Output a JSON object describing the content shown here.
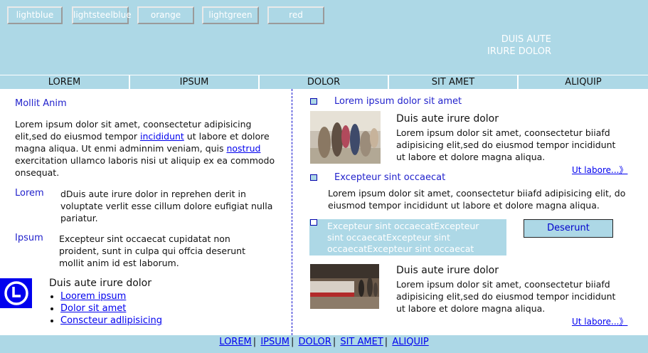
{
  "header": {
    "color_buttons": [
      "lightblue",
      "lightsteelblue",
      "orange",
      "lightgreen",
      "red"
    ],
    "title_line1": "DUIS AUTE",
    "title_line2": "IRURE DOLOR"
  },
  "nav": [
    "LOREM",
    "IPSUM",
    "DOLOR",
    "SIT AMET",
    "ALIQUIP"
  ],
  "left": {
    "title": "Mollit Anim",
    "intro": {
      "t1": "Lorem ipsum dolor sit amet, coonsectetur adipisicing elit,sed do eiusmod tempor ",
      "link1": "incididunt",
      "t2": " ut labore et dolore magna aliqua. Ut enmi adminnim veniam, quis ",
      "link2": "nostrud",
      "t3": " exercitation ullamco laboris nisi ut aliquip ex ea commodo onsequat."
    },
    "definitions": [
      {
        "term": "Lorem",
        "desc": "dDuis aute irure dolor in reprehen derit in voluptate verlit esse cillum dolore eufigiat nulla pariatur."
      },
      {
        "term": "Ipsum",
        "desc": "Excepteur sint occaecat cupidatat non proident, sunt in culpa qui offcia deserunt mollit anim id est laborum."
      }
    ],
    "list_heading": "Duis aute irure dolor",
    "list": [
      "Loorem ipsum",
      "Dolor sit amet",
      "Conscteur adlipisicing"
    ]
  },
  "right": {
    "item1_title": "Lorem ipsum dolor sit amet",
    "article1": {
      "heading": "Duis aute irure dolor",
      "text": "Lorem ipsum dolor sit amet, coonsectetur biiafd adipisicing elit,sed do eiusmod tempor incididunt ut labore et dolore magna aliqua.",
      "more": "Ut labore...》"
    },
    "item2_title": "Excepteur sint occaecat",
    "item2_text": "Lorem ipsum dolor sit amet, coonsectetur biiafd adipisicing elit, do eiusmod tempor incididunt ut labore et dolore magna aliqua.",
    "highlight": "Excepteur sint occaecatExcepteur sint occaecatExcepteur sint occaecatExcepteur sint occaecat",
    "button": "Deserunt",
    "article2": {
      "heading": "Duis aute irure dolor",
      "text": "Lorem ipsum dolor sit amet, coonsectetur biiafd adipisicing elit,sed do eiusmod tempor incididunt ut labore et dolore magna aliqua.",
      "more": "Ut labore...》"
    }
  },
  "footer": [
    "LOREM",
    "IPSUM",
    "DOLOR",
    "SIT AMET",
    "ALIQUIP"
  ],
  "colors": {
    "accent": "#add8e6",
    "link": "#0000ee",
    "clock_bg": "#0000ee"
  }
}
